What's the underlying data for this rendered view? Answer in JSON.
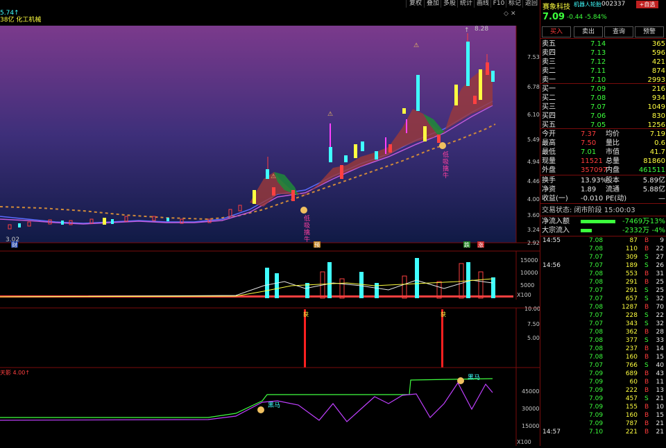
{
  "toolbar": {
    "buttons": [
      "复权",
      "叠加",
      "多股",
      "统计",
      "画线",
      "F10",
      "标记",
      "返回"
    ]
  },
  "chart": {
    "info_line1": "5.74↑",
    "info_line2": "38亿 化工机械",
    "price_ticks": [
      "7.53",
      "6.78",
      "6.10",
      "5.49",
      "4.94",
      "4.46",
      "4.00",
      "3.60",
      "3.24",
      "2.92"
    ],
    "high_label": "8.28",
    "low_label": "3.02",
    "markers": {
      "cai": "财",
      "yu": "预",
      "die": "跌",
      "zhang": "涨",
      "huo": "获"
    },
    "signal_text": [
      "低",
      "吸",
      "擒",
      "牛"
    ],
    "vol_ticks": [
      "15000",
      "10000",
      "5000"
    ],
    "vol_unit": "X100",
    "ind2_ticks": [
      "10.00",
      "7.50",
      "5.00"
    ],
    "ind3_title": "天影 4.00↑",
    "ind3_ticks": [
      "45000",
      "30000",
      "15000"
    ],
    "ind3_unit": "X100",
    "heima": "黑马"
  },
  "panel": {
    "name": "赛象科技",
    "tag": "机器人轮胎",
    "code": "002337",
    "add_btn": "+自选",
    "price": "7.09",
    "change": "-0.44",
    "pct": "-5.84%",
    "buttons": [
      "买入",
      "卖出",
      "查询",
      "预警"
    ],
    "asks": [
      {
        "label": "卖五",
        "price": "7.14",
        "vol": "365"
      },
      {
        "label": "卖四",
        "price": "7.13",
        "vol": "596"
      },
      {
        "label": "卖三",
        "price": "7.12",
        "vol": "421"
      },
      {
        "label": "卖二",
        "price": "7.11",
        "vol": "874"
      },
      {
        "label": "卖一",
        "price": "7.10",
        "vol": "2993"
      }
    ],
    "bids": [
      {
        "label": "买一",
        "price": "7.09",
        "vol": "216"
      },
      {
        "label": "买二",
        "price": "7.08",
        "vol": "934"
      },
      {
        "label": "买三",
        "price": "7.07",
        "vol": "1049"
      },
      {
        "label": "买四",
        "price": "7.06",
        "vol": "830"
      },
      {
        "label": "买五",
        "price": "7.05",
        "vol": "1256"
      }
    ],
    "stats": [
      {
        "l1": "今开",
        "v1": "7.37",
        "l2": "均价",
        "v2": "7.19"
      },
      {
        "l1": "最高",
        "v1": "7.50",
        "l2": "量比",
        "v2": "0.6"
      },
      {
        "l1": "最低",
        "v1": "7.01",
        "l2": "市值",
        "v2": "41.7"
      },
      {
        "l1": "现量",
        "v1": "11521",
        "l2": "总量",
        "v2": "81860"
      },
      {
        "l1": "外盘",
        "v1": "357097",
        "l2": "内盘",
        "v2": "461511"
      }
    ],
    "stats2": [
      {
        "l1": "换手",
        "v1": "13.93%",
        "l2": "股本",
        "v2": "5.89亿"
      },
      {
        "l1": "净资",
        "v1": "1.89",
        "l2": "流通",
        "v2": "5.88亿"
      },
      {
        "l1": "收益(一)",
        "v1": "-0.010",
        "l2": "PE(动)",
        "v2": "—"
      }
    ],
    "trade_status": "交易状态: 闭市阶段 15:00:03",
    "flow": [
      {
        "label": "净流入额",
        "value": "-7469万",
        "pct": "-13%"
      },
      {
        "label": "大宗流入",
        "value": "-2332万",
        "pct": "-4%"
      }
    ],
    "ticks": [
      {
        "t": "14:55",
        "p": "7.08",
        "v": "87",
        "d": "B",
        "n": "9"
      },
      {
        "t": "",
        "p": "7.08",
        "v": "110",
        "d": "B",
        "n": "22"
      },
      {
        "t": "",
        "p": "7.07",
        "v": "309",
        "d": "S",
        "n": "27"
      },
      {
        "t": "14:56",
        "p": "7.07",
        "v": "189",
        "d": "S",
        "n": "26"
      },
      {
        "t": "",
        "p": "7.08",
        "v": "553",
        "d": "B",
        "n": "31"
      },
      {
        "t": "",
        "p": "7.08",
        "v": "291",
        "d": "B",
        "n": "25"
      },
      {
        "t": "",
        "p": "7.07",
        "v": "291",
        "d": "S",
        "n": "25"
      },
      {
        "t": "",
        "p": "7.07",
        "v": "657",
        "d": "S",
        "n": "32"
      },
      {
        "t": "",
        "p": "7.08",
        "v": "1287",
        "d": "B",
        "n": "70"
      },
      {
        "t": "",
        "p": "7.07",
        "v": "228",
        "d": "S",
        "n": "22"
      },
      {
        "t": "",
        "p": "7.07",
        "v": "343",
        "d": "S",
        "n": "32"
      },
      {
        "t": "",
        "p": "7.08",
        "v": "362",
        "d": "B",
        "n": "28"
      },
      {
        "t": "",
        "p": "7.08",
        "v": "377",
        "d": "S",
        "n": "33"
      },
      {
        "t": "",
        "p": "7.08",
        "v": "237",
        "d": "B",
        "n": "14"
      },
      {
        "t": "",
        "p": "7.08",
        "v": "160",
        "d": "B",
        "n": "15"
      },
      {
        "t": "",
        "p": "7.07",
        "v": "766",
        "d": "S",
        "n": "40"
      },
      {
        "t": "",
        "p": "7.09",
        "v": "689",
        "d": "B",
        "n": "43"
      },
      {
        "t": "",
        "p": "7.09",
        "v": "60",
        "d": "B",
        "n": "11"
      },
      {
        "t": "",
        "p": "7.09",
        "v": "222",
        "d": "B",
        "n": "13"
      },
      {
        "t": "",
        "p": "7.09",
        "v": "457",
        "d": "S",
        "n": "21"
      },
      {
        "t": "",
        "p": "7.09",
        "v": "155",
        "d": "B",
        "n": "10"
      },
      {
        "t": "",
        "p": "7.09",
        "v": "160",
        "d": "B",
        "n": "15"
      },
      {
        "t": "",
        "p": "7.09",
        "v": "787",
        "d": "B",
        "n": "21"
      },
      {
        "t": "14:57",
        "p": "7.10",
        "v": "221",
        "d": "B",
        "n": "21"
      }
    ],
    "colors": {
      "up": "#ff3c3c",
      "down": "#3cff3c",
      "accent": "#ffff40",
      "frame": "#7a0c0c"
    }
  }
}
